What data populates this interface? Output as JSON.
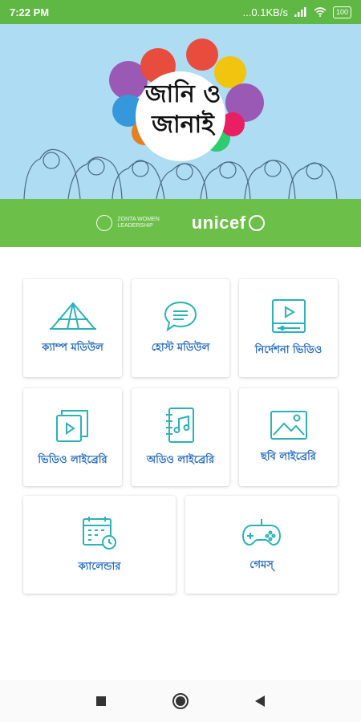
{
  "status_bar": {
    "time": "7:22 PM",
    "network_speed": "...0.1KB/s",
    "battery": "100"
  },
  "banner": {
    "title_line1": "জানি ও",
    "title_line2": "জানাই"
  },
  "partners": {
    "zonta_line1": "ZONTA WOMEN",
    "zonta_line2": "LEADERSHIP",
    "unicef": "unicef"
  },
  "modules": [
    {
      "label": "ক্যাম্প মডিউল",
      "icon": "tent-icon"
    },
    {
      "label": "হোস্ট মডিউল",
      "icon": "chat-bubble-icon"
    },
    {
      "label": "নির্দেশনা ভিডিও",
      "icon": "video-player-icon"
    },
    {
      "label": "ভিডিও লাইব্রেরি",
      "icon": "video-library-icon"
    },
    {
      "label": "অডিও লাইব্রেরি",
      "icon": "music-notebook-icon"
    },
    {
      "label": "ছবি লাইব্রেরি",
      "icon": "image-icon"
    },
    {
      "label": "ক্যালেন্ডার",
      "icon": "calendar-icon"
    },
    {
      "label": "গেমস্",
      "icon": "gamepad-icon"
    }
  ],
  "colors": {
    "accent_green": "#6cc04a",
    "status_green": "#5fb844",
    "banner_blue": "#aedcf2",
    "label_blue": "#2a6fc0",
    "icon_teal": "#2bb2b7"
  }
}
